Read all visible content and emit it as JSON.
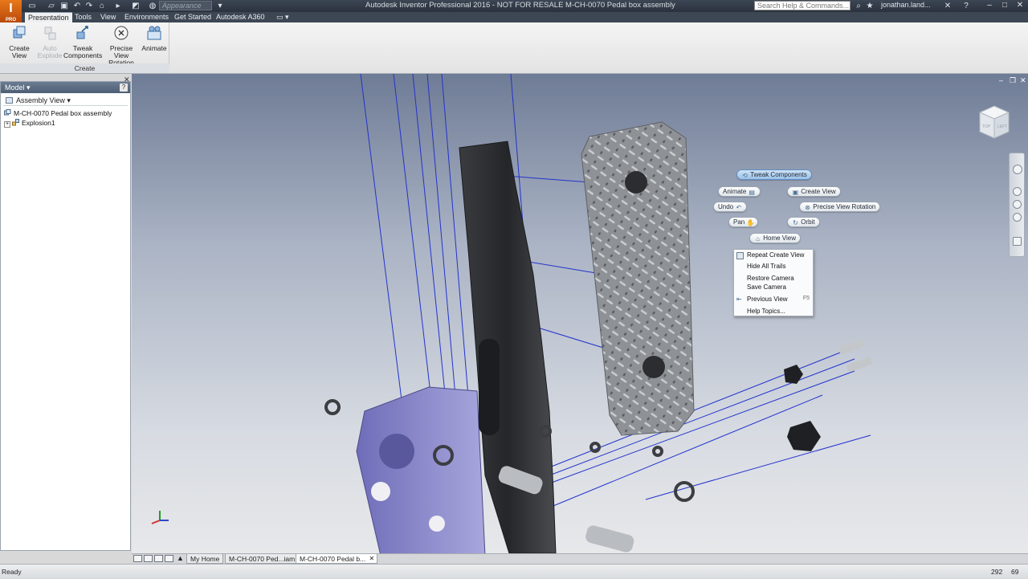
{
  "window": {
    "title": "Autodesk Inventor Professional 2016 - NOT FOR RESALE    M-CH-0070 Pedal box assembly",
    "app_logo_letter": "I",
    "app_logo_sub": "PRO",
    "appearance_placeholder": "Appearance",
    "help_search_placeholder": "Search Help & Commands...",
    "user_name": "jonathan.land..."
  },
  "tabs": [
    "Presentation",
    "Tools",
    "View",
    "Environments",
    "Get Started",
    "Autodesk A360"
  ],
  "active_tab": "Presentation",
  "ribbon": {
    "group_label": "Create",
    "buttons": [
      {
        "label": "Create View",
        "enabled": true,
        "icon": "create-view-icon"
      },
      {
        "label": "Auto Explode",
        "enabled": false,
        "icon": "auto-explode-icon"
      },
      {
        "label": "Tweak Components",
        "enabled": true,
        "icon": "tweak-components-icon"
      },
      {
        "label": "Precise View Rotation",
        "enabled": true,
        "icon": "precise-view-rotation-icon"
      },
      {
        "label": "Animate",
        "enabled": true,
        "icon": "animate-icon"
      }
    ]
  },
  "browser": {
    "title": "Model",
    "view_selector": "Assembly View",
    "tree": [
      {
        "label": "M-CH-0070 Pedal box assembly",
        "level": 0,
        "icon": "assembly-icon"
      },
      {
        "label": "Explosion1",
        "level": 1,
        "icon": "explosion-icon"
      }
    ]
  },
  "marking_menu": {
    "top": "Tweak Components",
    "left_items": [
      "Animate",
      "Undo",
      "Pan"
    ],
    "right_items": [
      "Create View",
      "Precise View Rotation",
      "Orbit"
    ],
    "bottom": "Home View"
  },
  "context_menu": {
    "items": [
      {
        "label": "Repeat Create View",
        "shortcut": ""
      },
      {
        "label": "Hide All Trails",
        "shortcut": ""
      },
      {
        "label": "Restore Camera",
        "shortcut": ""
      },
      {
        "label": "Save Camera",
        "shortcut": ""
      },
      {
        "label": "Previous View",
        "shortcut": "F5"
      },
      {
        "label": "Help Topics...",
        "shortcut": ""
      }
    ]
  },
  "viewcube": {
    "left_face": "TOP",
    "right_face": "LEFT"
  },
  "document_tabs": [
    {
      "label": "My Home",
      "active": false
    },
    {
      "label": "M-CH-0070 Ped...iam",
      "active": false
    },
    {
      "label": "M-CH-0070 Pedal b...",
      "active": true
    }
  ],
  "status": {
    "text": "Ready",
    "count_a": "292",
    "count_b": "69"
  },
  "colors": {
    "accent": "#3d4754",
    "trail": "#2233cc",
    "viewport_top": "#6f7c96",
    "plate_purple": "#8a88c8"
  }
}
